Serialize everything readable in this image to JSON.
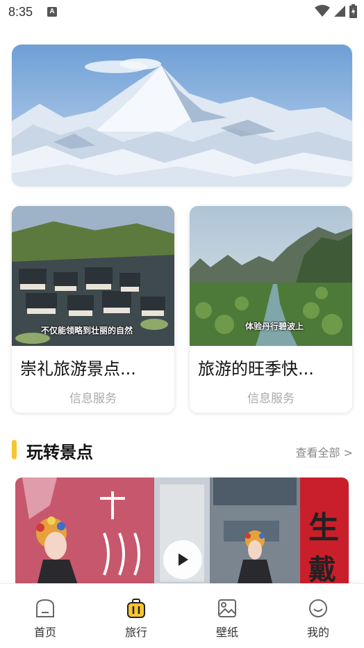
{
  "status_bar": {
    "time": "8:35",
    "notification_icon": "a-icon"
  },
  "cards": [
    {
      "title": "崇礼旅游景点...",
      "subtitle": "信息服务",
      "caption": "不仅能领略到壮丽的自然"
    },
    {
      "title": "旅游的旺季快...",
      "subtitle": "信息服务",
      "caption": "体验丹行碧波上"
    }
  ],
  "section": {
    "title": "玩转景点",
    "see_all": "查看全部 >"
  },
  "video": {
    "calligraphy_1": "生",
    "calligraphy_2": "戴"
  },
  "nav": [
    {
      "label": "首页",
      "icon": "home-icon",
      "active": false
    },
    {
      "label": "旅行",
      "icon": "suitcase-icon",
      "active": true
    },
    {
      "label": "壁纸",
      "icon": "image-icon",
      "active": false
    },
    {
      "label": "我的",
      "icon": "smile-icon",
      "active": false
    }
  ],
  "colors": {
    "accent": "#f7c531",
    "text_muted": "#aaaaaa"
  }
}
